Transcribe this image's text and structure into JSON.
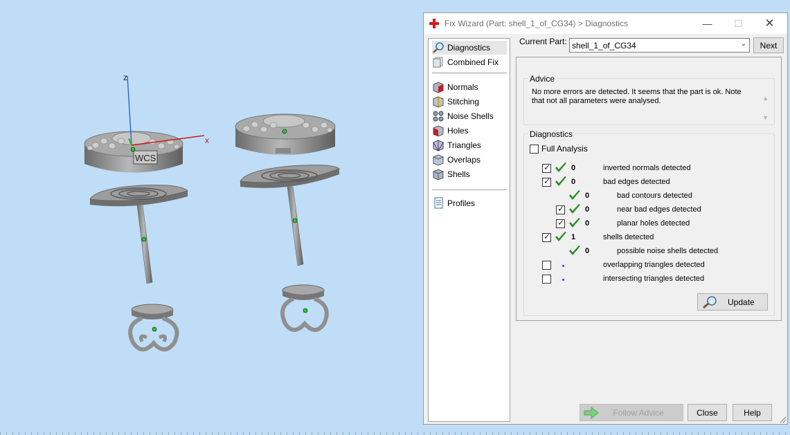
{
  "viewport": {
    "axis_z": "z",
    "axis_x": "x",
    "wcs_label": "WCS"
  },
  "dialog": {
    "title": "Fix Wizard (Part: shell_1_of_CG34) > Diagnostics",
    "window_controls": {
      "minimize": "—",
      "maximize": "☐",
      "close": "✕"
    }
  },
  "nav": {
    "items": [
      {
        "label": "Diagnostics",
        "icon": "magnifier-icon"
      },
      {
        "label": "Combined Fix",
        "icon": "combined-fix-icon"
      },
      {
        "label": "Normals",
        "icon": "normals-icon"
      },
      {
        "label": "Stitching",
        "icon": "stitching-icon"
      },
      {
        "label": "Noise Shells",
        "icon": "noise-shells-icon"
      },
      {
        "label": "Holes",
        "icon": "holes-icon"
      },
      {
        "label": "Triangles",
        "icon": "triangles-icon"
      },
      {
        "label": "Overlaps",
        "icon": "overlaps-icon"
      },
      {
        "label": "Shells",
        "icon": "shells-icon"
      },
      {
        "label": "Profiles",
        "icon": "profiles-icon"
      }
    ]
  },
  "current_part": {
    "label": "Current Part:",
    "value": "shell_1_of_CG34",
    "next_label": "Next"
  },
  "advice": {
    "title": "Advice",
    "text": "No more errors are detected. It seems that the part is ok. Note that not all parameters were analysed."
  },
  "diagnostics": {
    "title": "Diagnostics",
    "full_analysis_label": "Full Analysis",
    "rows": [
      {
        "checkbox": "checked",
        "status": "ok",
        "count": "0",
        "label": "inverted normals detected"
      },
      {
        "checkbox": "checked",
        "status": "ok",
        "count": "0",
        "label": "bad edges detected"
      },
      {
        "checkbox": "none",
        "status": "ok",
        "count": "0",
        "label": "bad contours detected"
      },
      {
        "checkbox": "checked",
        "status": "ok",
        "count": "0",
        "label": "near bad edges detected"
      },
      {
        "checkbox": "checked",
        "status": "ok",
        "count": "0",
        "label": "planar holes detected"
      },
      {
        "checkbox": "checked",
        "status": "ok",
        "count": "1",
        "label": "shells detected"
      },
      {
        "checkbox": "none",
        "status": "ok",
        "count": "0",
        "label": "possible noise shells detected"
      },
      {
        "checkbox": "unchecked",
        "status": "pending",
        "count": "",
        "label": "overlapping triangles detected"
      },
      {
        "checkbox": "unchecked",
        "status": "pending",
        "count": "",
        "label": "intersecting triangles detected"
      }
    ],
    "update_label": "Update"
  },
  "footer": {
    "follow_advice_label": "Follow Advice",
    "close_label": "Close",
    "help_label": "Help"
  },
  "colors": {
    "viewport_bg": "#bfddf6",
    "check_green": "#2e8b2e",
    "axis_red": "#d01818",
    "axis_blue": "#1f5fd0"
  }
}
